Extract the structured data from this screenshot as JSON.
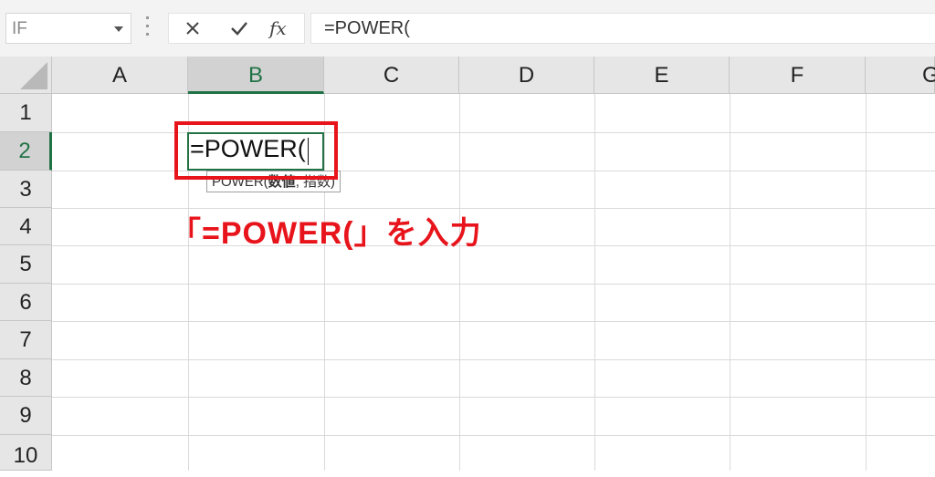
{
  "formula_bar": {
    "name_box": "IF",
    "cancel_icon": "close-icon",
    "enter_icon": "checkmark-icon",
    "fx_label": "fx",
    "formula": "=POWER("
  },
  "columns": [
    "A",
    "B",
    "C",
    "D",
    "E",
    "F",
    "G"
  ],
  "rows": [
    "1",
    "2",
    "3",
    "4",
    "5",
    "6",
    "7",
    "8",
    "9",
    "10"
  ],
  "selected_column": "B",
  "selected_row": "2",
  "active_cell": {
    "content": "=POWER(",
    "tooltip_func": "POWER(",
    "tooltip_arg1": "数値",
    "tooltip_rest": ", 指数)"
  },
  "annotation": "「=POWER(」を入力",
  "colors": {
    "accent_green": "#217346",
    "highlight_red": "#e8141b"
  }
}
